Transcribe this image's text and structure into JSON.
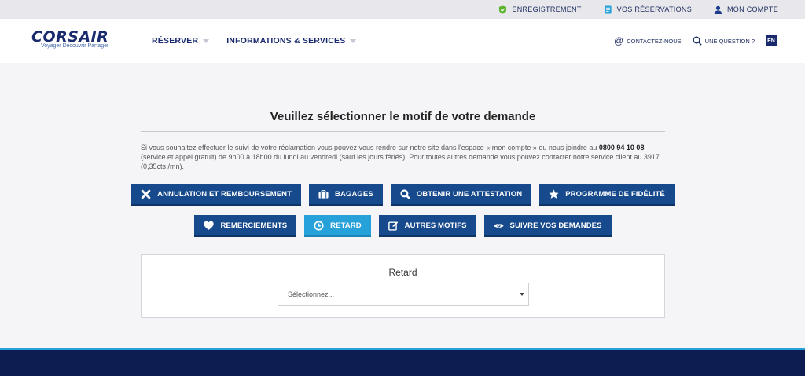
{
  "topbar": {
    "items": [
      {
        "label": "ENREGISTREMENT",
        "icon": "shield-check-icon"
      },
      {
        "label": "VOS RÉSERVATIONS",
        "icon": "document-icon"
      },
      {
        "label": "MON COMPTE",
        "icon": "user-icon"
      }
    ]
  },
  "header": {
    "brand": "CORSAIR",
    "tagline": "Voyager Découvrir Partager",
    "nav": [
      {
        "label": "RÉSERVER"
      },
      {
        "label": "INFORMATIONS & SERVICES"
      }
    ],
    "contact_label": "CONTACTEZ-NOUS",
    "question_label": "UNE QUESTION ?",
    "lang": "EN"
  },
  "main": {
    "title": "Veuillez sélectionner le motif de votre demande",
    "intro_part1": "Si vous souhaitez effectuer le suivi de votre réclamation vous pouvez vous rendre sur notre site dans l'espace « mon compte » ou nous joindre au ",
    "intro_phone": "0800 94 10 08",
    "intro_part2": " (service et appel gratuit) de 9h00 à 18h00 du lundi au vendredi (sauf les jours fériés). Pour toutes autres demande vous pouvez contacter notre service client au 3917 (0,35cts /mn).",
    "buttons_row1": [
      {
        "label": "ANNULATION ET REMBOURSEMENT",
        "icon": "x-icon"
      },
      {
        "label": "BAGAGES",
        "icon": "suitcase-icon"
      },
      {
        "label": "OBTENIR UNE ATTESTATION",
        "icon": "search-icon"
      },
      {
        "label": "PROGRAMME DE FIDÉLITÉ",
        "icon": "star-icon"
      }
    ],
    "buttons_row2": [
      {
        "label": "REMERCIEMENTS",
        "icon": "heart-icon"
      },
      {
        "label": "RETARD",
        "icon": "clock-icon",
        "active": true
      },
      {
        "label": "AUTRES MOTIFS",
        "icon": "edit-icon"
      },
      {
        "label": "SUIVRE VOS DEMANDES",
        "icon": "eye-icon"
      }
    ]
  },
  "panel": {
    "title": "Retard",
    "select_placeholder": "Sélectionnez..."
  },
  "colors": {
    "brand": "#1a2a6e",
    "button": "#174a8c",
    "active": "#27a1da",
    "footer": "#0d1d52"
  }
}
